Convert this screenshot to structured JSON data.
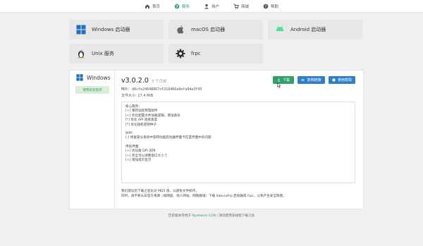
{
  "nav": {
    "items": [
      {
        "label": "首页",
        "icon": "home-icon"
      },
      {
        "label": "服务",
        "icon": "globe-icon"
      },
      {
        "label": "用户",
        "icon": "user-icon"
      },
      {
        "label": "商城",
        "icon": "cart-icon"
      },
      {
        "label": "帮助",
        "icon": "help-icon"
      }
    ],
    "active_color": "#2f9e6e"
  },
  "platforms": [
    {
      "label": "Windows 启动器",
      "icon": "windows-icon"
    },
    {
      "label": "macOS 启动器",
      "icon": "apple-icon"
    },
    {
      "label": "Android 启动器",
      "icon": "android-icon"
    },
    {
      "label": "Unix 服务",
      "icon": "linux-icon"
    },
    {
      "label": "frpc",
      "icon": "gear-icon"
    }
  ],
  "release": {
    "os_name": "Windows",
    "use_installer": "使用安装程序",
    "version": "v3.0.2.0",
    "age": "3 个月前",
    "md5": "MD5: d8cfe24648867c5318466a9efa84e3f95",
    "size": "文件大小: 17.4 MiB",
    "buttons": {
      "download": "下载",
      "copy_link": "复制链接",
      "help": "使用帮助"
    },
    "notes": [
      "核心服务:",
      "[+] 重新远程管理组件",
      "[+] 优化配置文件加载逻辑，增设备份",
      "[*] 优化 API 连接速度",
      "[*] 优化随机密钥种子",
      "",
      "WPF:",
      "[-] 修复部分系统中旋转动画启动器界面卡在首界面中的问题",
      "",
      "传统界面:",
      "[+] 优化版 DPI 支持",
      "[+] 完全可以调整窗口大小了",
      "[+] 增加提示显示"
    ],
    "warning_1": "我们建议您下载之后比对 MD5 值，以避免文件损坏。",
    "warning_2": "同时，请不要从非官方来源（如网盘、他人网站、网络群组）下载 SakuraFrp 启动器或 frpc，以免产生安全隐患。"
  },
  "footer": {
    "prefix": "历史版本存档于",
    "host": "Nyatwork CDN",
    "separator": "|",
    "mirror": "请勿使用多线程下载工具"
  }
}
